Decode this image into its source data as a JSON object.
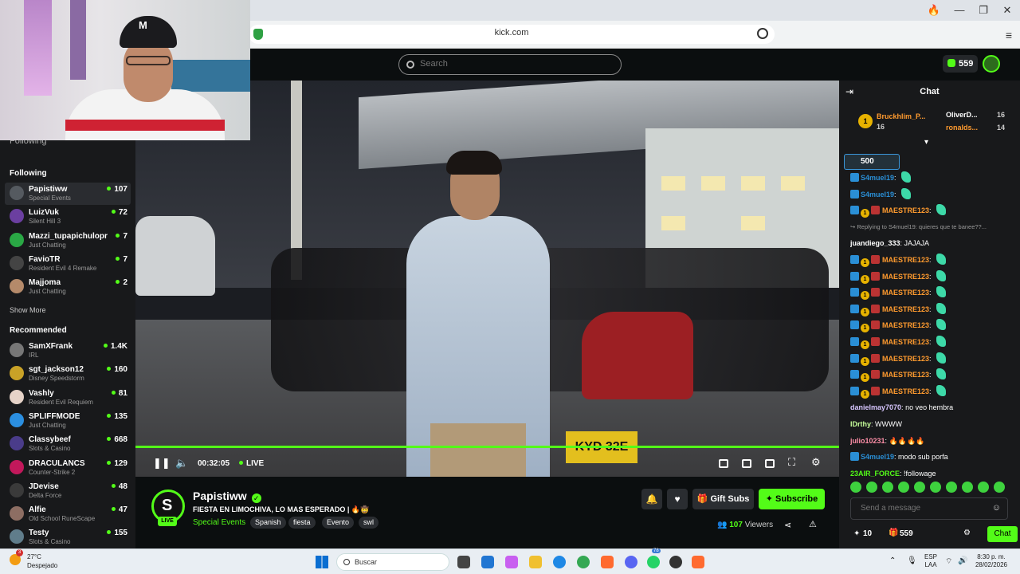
{
  "browser": {
    "url": "kick.com",
    "window_controls": [
      "🔥",
      "—",
      "❐",
      "✕"
    ]
  },
  "header": {
    "search_placeholder": "Search",
    "kicks_balance": "559"
  },
  "sidebar": {
    "following_top_label": "Following",
    "following_title": "Following",
    "following": [
      {
        "name": "Papistiww",
        "category": "Special Events",
        "viewers": "107",
        "color": "#555a60"
      },
      {
        "name": "LuizVuk",
        "category": "Silent Hill 3",
        "viewers": "72",
        "color": "#6b3fa0"
      },
      {
        "name": "Mazzi_tupapichulopr",
        "category": "Just Chatting",
        "viewers": "7",
        "color": "#2aa845"
      },
      {
        "name": "FavioTR",
        "category": "Resident Evil 4 Remake",
        "viewers": "7",
        "color": "#444"
      },
      {
        "name": "Majjoma",
        "category": "Just Chatting",
        "viewers": "2",
        "color": "#b58a6a"
      }
    ],
    "show_more": "Show More",
    "recommended_title": "Recommended",
    "recommended": [
      {
        "name": "SamXFrank",
        "category": "IRL",
        "viewers": "1.4K",
        "color": "#777"
      },
      {
        "name": "sgt_jackson12",
        "category": "Disney Speedstorm",
        "viewers": "160",
        "color": "#c9a227"
      },
      {
        "name": "Vashly",
        "category": "Resident Evil Requiem",
        "viewers": "81",
        "color": "#e6d3c8"
      },
      {
        "name": "SPLIFFMODE",
        "category": "Just Chatting",
        "viewers": "135",
        "color": "#2b8fe0"
      },
      {
        "name": "Classybeef",
        "category": "Slots & Casino",
        "viewers": "668",
        "color": "#4a3c8a"
      },
      {
        "name": "DRACULANCS",
        "category": "Counter-Strike 2",
        "viewers": "129",
        "color": "#c2185b"
      },
      {
        "name": "JDevise",
        "category": "Delta Force",
        "viewers": "48",
        "color": "#3a3a3a"
      },
      {
        "name": "Alfie",
        "category": "Old School RuneScape",
        "viewers": "47",
        "color": "#8d6e63"
      },
      {
        "name": "Testy",
        "category": "Slots & Casino",
        "viewers": "155",
        "color": "#607d8b"
      }
    ]
  },
  "player": {
    "elapsed": "00:32:05",
    "live_label": "LIVE",
    "plate_text": "KYD 32E",
    "progress": 1.0
  },
  "stream": {
    "channel": "Papistiww",
    "live_badge": "LIVE",
    "title": "FIESTA EN LIMOCHIVA, LO MAS ESPERADO | 🔥🤠",
    "category": "Special Events",
    "tags": [
      "Spanish",
      "fiesta",
      "Evento",
      "swl"
    ],
    "gift_label": "Gift Subs",
    "subscribe_label": "Subscribe",
    "viewers_count": "107",
    "viewers_label": "Viewers"
  },
  "chat": {
    "title": "Chat",
    "pinned": {
      "top_user": "Bruckhlim_P...",
      "top_user_count": "16",
      "second_user": "OliverD...",
      "second_count": "16",
      "third_user": "ronalds...",
      "third_count": "14",
      "rank": "1"
    },
    "kicks_box": "500",
    "messages": [
      {
        "type": "msg",
        "user": "S4muel19",
        "color": "#2a8fd6",
        "text": "",
        "badges": "b1",
        "emote": true
      },
      {
        "type": "msg",
        "user": "S4muel19",
        "color": "#2a8fd6",
        "text": "",
        "badges": "b1",
        "emote": true
      },
      {
        "type": "msg",
        "user": "MAESTRE123",
        "color": "#ff9b2f",
        "text": "",
        "badges": "b1b2b3",
        "emote": true
      },
      {
        "type": "reply",
        "text": "↪ Replying to S4muel19: quieres que te banee??..."
      },
      {
        "type": "msg",
        "user": "juandiego_333",
        "color": "#ffffff",
        "text": "JAJAJA",
        "badges": "",
        "emote": false
      },
      {
        "type": "msg",
        "user": "MAESTRE123",
        "color": "#ff9b2f",
        "text": "",
        "badges": "b1b2b3",
        "emote": true
      },
      {
        "type": "msg",
        "user": "MAESTRE123",
        "color": "#ff9b2f",
        "text": "",
        "badges": "b1b2b3",
        "emote": true
      },
      {
        "type": "msg",
        "user": "MAESTRE123",
        "color": "#ff9b2f",
        "text": "",
        "badges": "b1b2b3",
        "emote": true
      },
      {
        "type": "msg",
        "user": "MAESTRE123",
        "color": "#ff9b2f",
        "text": "",
        "badges": "b1b2b3",
        "emote": true
      },
      {
        "type": "msg",
        "user": "MAESTRE123",
        "color": "#ff9b2f",
        "text": "",
        "badges": "b1b2b3",
        "emote": true
      },
      {
        "type": "msg",
        "user": "MAESTRE123",
        "color": "#ff9b2f",
        "text": "",
        "badges": "b1b2b3",
        "emote": true
      },
      {
        "type": "msg",
        "user": "MAESTRE123",
        "color": "#ff9b2f",
        "text": "",
        "badges": "b1b2b3",
        "emote": true
      },
      {
        "type": "msg",
        "user": "MAESTRE123",
        "color": "#ff9b2f",
        "text": "",
        "badges": "b1b2b3",
        "emote": true
      },
      {
        "type": "msg",
        "user": "MAESTRE123",
        "color": "#ff9b2f",
        "text": "",
        "badges": "b1b2b3",
        "emote": true
      },
      {
        "type": "msg",
        "user": "danielmay7070",
        "color": "#d8c7ff",
        "text": "no veo hembra",
        "badges": "",
        "emote": false
      },
      {
        "type": "msg",
        "user": "IDrthy",
        "color": "#c7ff9b",
        "text": "WWWW",
        "badges": "",
        "emote": false
      },
      {
        "type": "msg",
        "user": "julio10231",
        "color": "#ff8fa8",
        "text": "🔥🔥🔥🔥",
        "badges": "",
        "emote": false
      },
      {
        "type": "msg",
        "user": "S4muel19",
        "color": "#2a8fd6",
        "text": "modo sub porfa",
        "badges": "b1",
        "emote": false
      },
      {
        "type": "msg",
        "user": "23AIR_FORCE",
        "color": "#53fc18",
        "text": "!followage",
        "badges": "",
        "emote": false
      }
    ],
    "input_placeholder": "Send a message",
    "points": "10",
    "gifts": "559",
    "chat_button": "Chat"
  },
  "taskbar": {
    "temperature": "27°C",
    "weather": "Despejado",
    "search_label": "Buscar",
    "lang_top": "ESP",
    "lang_bottom": "LAA",
    "time": "8:30 p. m.",
    "date": "28/02/2026",
    "notif_count": "3",
    "discord_badge": "78"
  }
}
